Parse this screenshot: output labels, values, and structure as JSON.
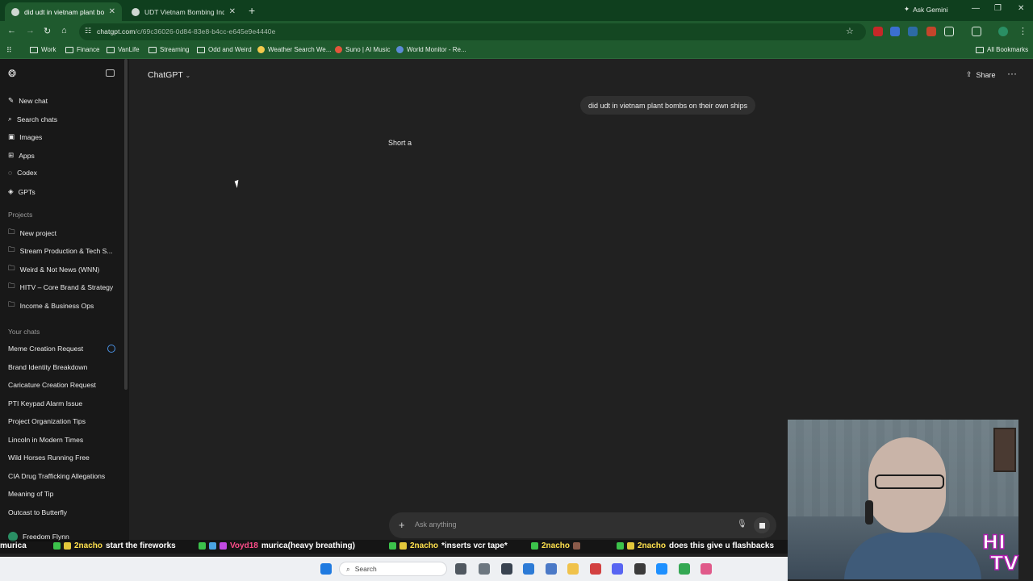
{
  "browser": {
    "tabs": [
      {
        "title": "did udt in vietnam plant bomb",
        "active": true
      },
      {
        "title": "UDT Vietnam Bombing Inquiry",
        "active": false
      }
    ],
    "ask_gemini": "Ask Gemini",
    "url_host": "chatgpt.com",
    "url_path": "/c/69c36026-0d84-83e8-b4cc-e645e9e4440e",
    "bookmarks": [
      {
        "label": "Work",
        "icon": "folder-icon"
      },
      {
        "label": "Finance",
        "icon": "folder-icon"
      },
      {
        "label": "VanLife",
        "icon": "folder-icon"
      },
      {
        "label": "Streaming",
        "icon": "folder-icon"
      },
      {
        "label": "Odd and Weird",
        "icon": "folder-icon"
      },
      {
        "label": "Weather Search We...",
        "icon": "weather-icon"
      },
      {
        "label": "Suno | AI Music",
        "icon": "suno-icon"
      },
      {
        "label": "World Monitor - Re...",
        "icon": "globe-icon"
      }
    ],
    "all_bookmarks": "All Bookmarks",
    "accent": "#1f5a2e"
  },
  "sidebar": {
    "nav": [
      {
        "label": "New chat",
        "icon": "edit-icon"
      },
      {
        "label": "Search chats",
        "icon": "search-icon"
      },
      {
        "label": "Images",
        "icon": "image-icon"
      },
      {
        "label": "Apps",
        "icon": "apps-icon"
      },
      {
        "label": "Codex",
        "icon": "codex-icon"
      },
      {
        "label": "GPTs",
        "icon": "gpts-icon"
      }
    ],
    "projects_heading": "Projects",
    "projects": [
      {
        "label": "New project",
        "icon": "new-folder-icon"
      },
      {
        "label": "Stream Production & Tech S...",
        "icon": "folder-icon"
      },
      {
        "label": "Weird & Not News (WNN)",
        "icon": "folder-icon"
      },
      {
        "label": "HITV – Core Brand & Strategy",
        "icon": "folder-icon"
      },
      {
        "label": "Income & Business Ops",
        "icon": "folder-icon"
      }
    ],
    "chats_heading": "Your chats",
    "chats": [
      "Meme Creation Request",
      "Brand Identity Breakdown",
      "Caricature Creation Request",
      "PTI Keypad Alarm Issue",
      "Project Organization Tips",
      "Lincoln in Modern Times",
      "Wild Horses Running Free",
      "CIA Drug Trafficking Allegations",
      "Meaning of Tip",
      "Outcast to Butterfly"
    ],
    "user_name": "Freedom Flynn"
  },
  "main": {
    "model": "ChatGPT",
    "share_label": "Share",
    "user_message": "did udt in vietnam plant bombs on their own ships",
    "assistant_partial": "Short a",
    "composer_placeholder": "Ask anything"
  },
  "stream_chat": [
    {
      "user": "",
      "message": "murica"
    },
    {
      "user": "2nacho",
      "message": "start the fireworks"
    },
    {
      "user": "Voyd18",
      "message": "murica(heavy breathing)"
    },
    {
      "user": "2nacho",
      "message": "*inserts vcr tape*"
    },
    {
      "user": "2nacho",
      "message": ""
    },
    {
      "user": "2nacho",
      "message": "does this give u flashbacks"
    }
  ],
  "taskbar": {
    "search_label": "Search"
  },
  "overlay_logo": "HI TV"
}
